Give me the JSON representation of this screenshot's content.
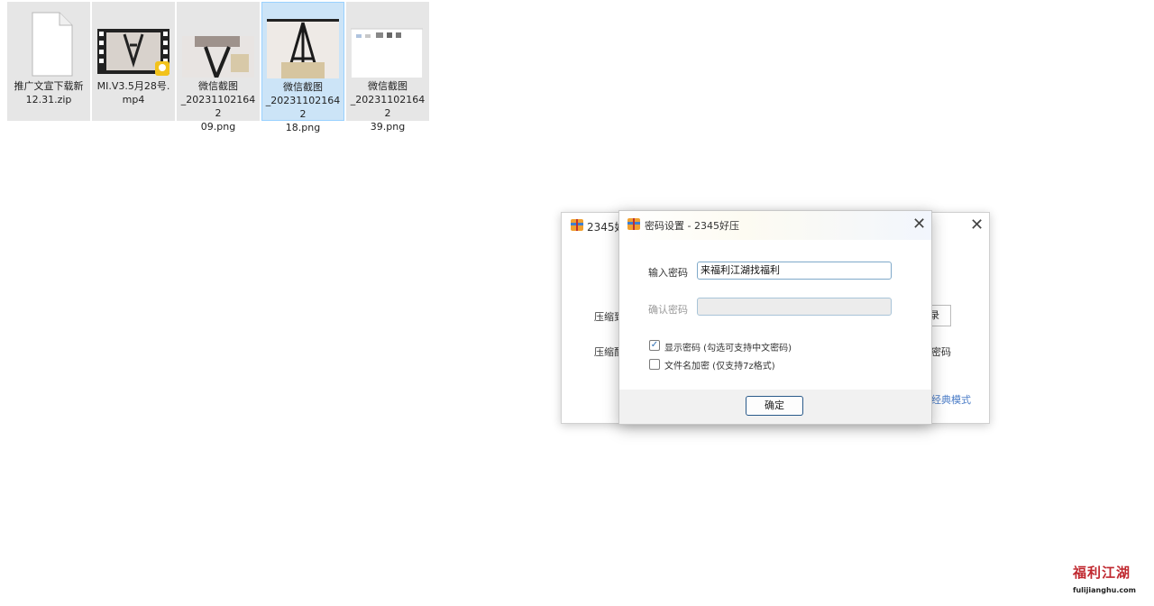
{
  "files": [
    {
      "name_line1": "推广文宣下载新",
      "name_line2": "12.31.zip",
      "icon": "zip-file-icon"
    },
    {
      "name_line1": "MI.V3.5月28号.",
      "name_line2": "mp4",
      "icon": "video-file-icon"
    },
    {
      "name_line1": "微信截图",
      "name_line2": "_202311021642",
      "name_line3": "09.png",
      "icon": "image-thumbnail"
    },
    {
      "name_line1": "微信截图",
      "name_line2": "_202311021642",
      "name_line3": "18.png",
      "icon": "image-thumbnail"
    },
    {
      "name_line1": "微信截图",
      "name_line2": "_202311021642",
      "name_line3": "39.png",
      "icon": "image-thumbnail"
    }
  ],
  "back_window": {
    "title": "2345好",
    "label_row1": "压缩到",
    "label_row2": "压缩配",
    "right_button_fragment": "录",
    "right_text_fragment": "密码",
    "classic_mode_link": "经典模式"
  },
  "dialog": {
    "title": "密码设置 - 2345好压",
    "password_label": "输入密码",
    "password_value": "来福利江湖找福利",
    "confirm_label": "确认密码",
    "confirm_value": "",
    "show_password_label": "显示密码 (勾选可支持中文密码)",
    "show_password_checked": true,
    "encrypt_filename_label": "文件名加密 (仅支持7z格式)",
    "encrypt_filename_checked": false,
    "ok_label": "确定",
    "check_glyph": "✓"
  },
  "watermark": {
    "brand": "福利江湖",
    "domain": "fulijianghu.com"
  },
  "colors": {
    "selected_tile": "#cce4f7",
    "accent_blue": "#2f6fb5",
    "link_blue": "#4a7cc7"
  }
}
